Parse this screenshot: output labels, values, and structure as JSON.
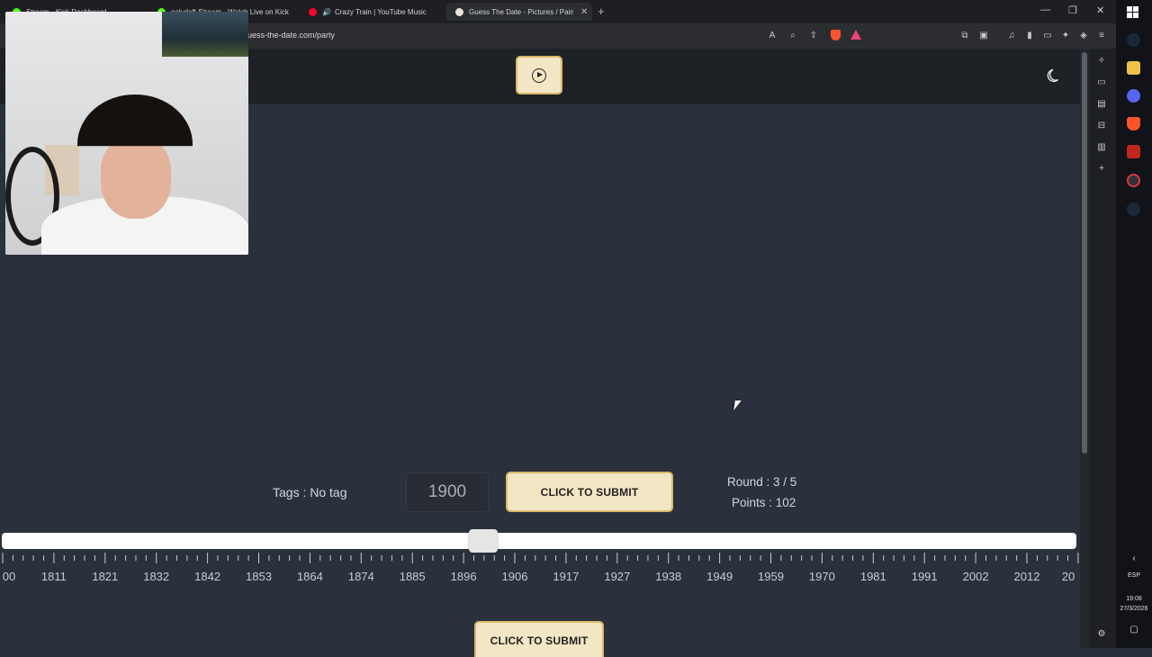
{
  "browser": {
    "tabs": [
      {
        "label": "Stream - Kick Dashboard",
        "color": "#53fc18"
      },
      {
        "label": "nelydeft Stream - Watch Live on Kick",
        "color": "#53fc18"
      },
      {
        "label": "Crazy Train | YouTube Music",
        "color": "#ff0033"
      },
      {
        "label": "Guess The Date - Pictures / Painti",
        "color": "#e9e4d6"
      }
    ],
    "new_tab": "+",
    "url": "uess-the-date.com/party"
  },
  "game": {
    "tags_label": "Tags : No tag",
    "year_value": "1900",
    "submit_label": "CLICK TO SUBMIT",
    "round_label": "Round : 3 / 5",
    "points_label": "Points : 102",
    "slider_value": 1900,
    "timeline_labels": [
      "00",
      "1811",
      "1821",
      "1832",
      "1842",
      "1853",
      "1864",
      "1874",
      "1885",
      "1896",
      "1906",
      "1917",
      "1927",
      "1938",
      "1949",
      "1959",
      "1970",
      "1981",
      "1991",
      "2002",
      "2012",
      "20"
    ],
    "bottom_submit_label": "CLICK TO SUBMIT"
  },
  "taskbar": {
    "language": "ESP",
    "time": "19:08",
    "date": "27/3/2026"
  },
  "colors": {
    "accent": "#f3e6c4",
    "accent_border": "#d8b96a",
    "background": "#2b313c",
    "header": "#1e2126"
  }
}
